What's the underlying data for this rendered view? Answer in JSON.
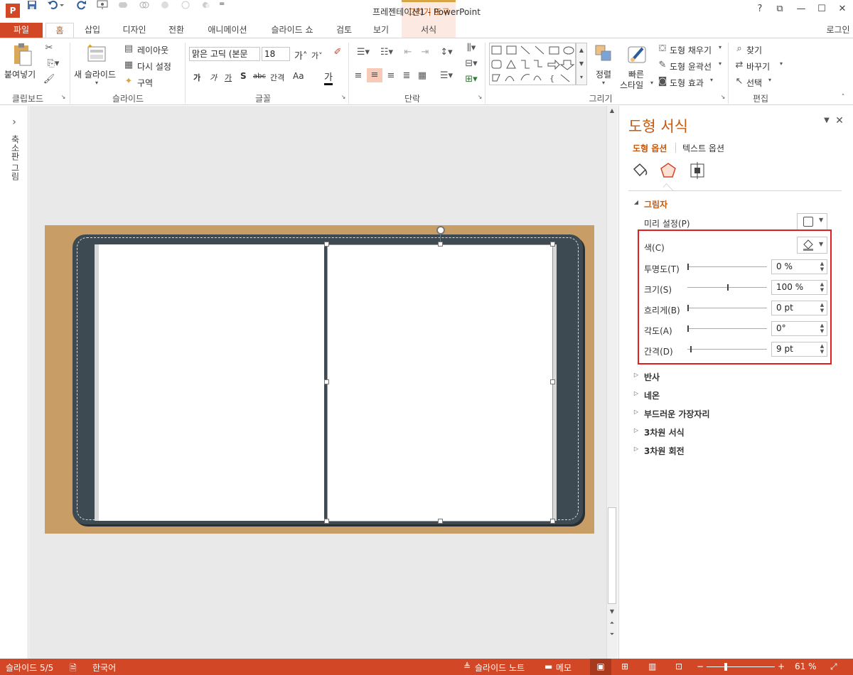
{
  "title_bar": {
    "doc_title": "프레젠테이션1 - PowerPoint",
    "contextual_tab_group": "그리기 도구",
    "app_icon": "P",
    "help": "?",
    "restore": "⧉",
    "minimize": "—",
    "maximize": "☐",
    "close": "✕"
  },
  "quick_access": {
    "save_icon": "💾",
    "undo_icon": "↶",
    "redo_icon": "↻",
    "more": "="
  },
  "tabs": [
    "파일",
    "홈",
    "삽입",
    "디자인",
    "전환",
    "애니메이션",
    "슬라이드 쇼",
    "검토",
    "보기",
    "서식"
  ],
  "signin": "로그인",
  "ribbon": {
    "clipboard": {
      "paste": "붙여넣기",
      "label": "클립보드"
    },
    "slides": {
      "new_slide": "새 슬라이드",
      "layout": "레이아웃",
      "reset": "다시 설정",
      "section": "구역",
      "label": "슬라이드"
    },
    "font": {
      "font_name": "맑은 고딕 (본문",
      "font_size": "18",
      "label": "글꼴",
      "buttons": [
        "가",
        "가",
        "가",
        "S",
        "abc",
        "간격",
        "Aa",
        "가"
      ]
    },
    "paragraph": {
      "label": "단락"
    },
    "drawing": {
      "arrange": "정렬",
      "quick_styles_1": "빠른",
      "quick_styles_2": "스타일",
      "shape_fill": "도형 채우기",
      "shape_outline": "도형 윤곽선",
      "shape_effects": "도형 효과",
      "label": "그리기"
    },
    "editing": {
      "find": "찾기",
      "replace": "바꾸기",
      "select": "선택",
      "label": "편집"
    }
  },
  "left_pane": {
    "label": "축소판 그림",
    "expand": "›"
  },
  "format_pane": {
    "title": "도형 서식",
    "tab_shape": "도형 옵션",
    "tab_text": "텍스트 옵션",
    "shadow": {
      "header": "그림자",
      "preset": "미리 설정(P)",
      "color": "색(C)",
      "transparency": {
        "label": "투명도(T)",
        "value": "0 %",
        "level": 0.0
      },
      "size": {
        "label": "크기(S)",
        "value": "100 %",
        "level": 0.5
      },
      "blur": {
        "label": "흐리게(B)",
        "value": "0 pt",
        "level": 0.0
      },
      "angle": {
        "label": "각도(A)",
        "value": "0°",
        "level": 0.0
      },
      "distance": {
        "label": "간격(D)",
        "value": "9 pt",
        "level": 0.04
      }
    },
    "sections": [
      "반사",
      "네온",
      "부드러운 가장자리",
      "3차원 서식",
      "3차원 회전"
    ]
  },
  "status_bar": {
    "slide_count": "슬라이드 5/5",
    "language": "한국어",
    "notes": "슬라이드 노트",
    "comments": "메모",
    "zoom": "61 %",
    "zoom_minus": "−",
    "zoom_plus": "+"
  },
  "colors": {
    "accent": "#d24726",
    "pane_title": "#c55a11",
    "highlight": "#e02020",
    "slide_bg": "#c89e66",
    "book": "#3e4a52"
  }
}
